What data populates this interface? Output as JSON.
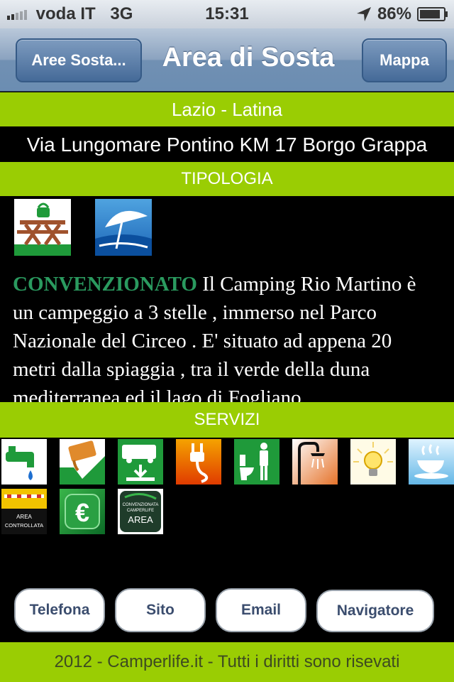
{
  "status_bar": {
    "carrier": "voda IT",
    "network": "3G",
    "time": "15:31",
    "battery": "86%"
  },
  "nav": {
    "back_label": "Aree Sosta...",
    "title": "Area di Sosta",
    "map_label": "Mappa"
  },
  "place": {
    "region": "Lazio - Latina",
    "address": "Via Lungomare Pontino KM 17  Borgo Grappa"
  },
  "sections": {
    "tipologia": "TIPOLOGIA",
    "servizi": "SERVIZI"
  },
  "description": {
    "highlight": "CONVENZIONATO",
    "text": " Il Camping Rio Martino è un campeggio a 3 stelle , immerso nel Parco Nazionale del Circeo . E' situato ad appena 20 metri dalla spiaggia , tra il verde della duna mediterranea ed il lago di Fogliano"
  },
  "tipologia_icons": [
    "picnic-area-icon",
    "beach-umbrella-icon"
  ],
  "services": {
    "icons": [
      "water-tap-icon",
      "grey-water-drain-icon",
      "camper-service-icon",
      "electric-plug-icon",
      "toilet-icon",
      "shower-icon",
      "light-bulb-icon",
      "hot-drink-icon",
      "controlled-area-icon",
      "euro-payment-icon",
      "convention-area-icon"
    ],
    "controlled_area_label_1": "AREA",
    "controlled_area_label_2": "CONTROLLATA",
    "convention_label_1": "CONVENZIONATA",
    "convention_label_2": "CAMPERLIFE",
    "convention_label_3": "AREA",
    "euro_symbol": "€"
  },
  "actions": {
    "phone": "Telefona",
    "site": "Sito",
    "email": "Email",
    "navigator": "Navigatore"
  },
  "footer": "2012 - Camperlife.it - Tutti i diritti sono risevati"
}
